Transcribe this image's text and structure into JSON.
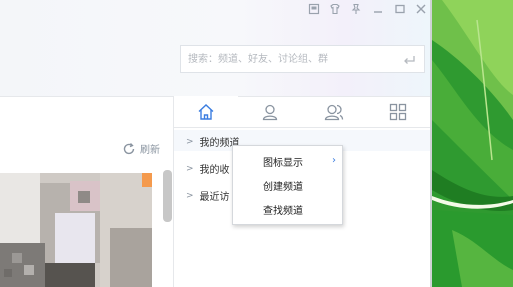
{
  "search": {
    "placeholder": "搜索：频道、好友、讨论组、群"
  },
  "refresh": {
    "label": "刷新"
  },
  "tree": {
    "items": [
      {
        "label": "我的频道"
      },
      {
        "label": "我的收"
      },
      {
        "label": "最近访"
      }
    ]
  },
  "context_menu": {
    "items": [
      {
        "label": "图标显示",
        "has_submenu": true
      },
      {
        "label": "创建频道"
      },
      {
        "label": "查找频道"
      }
    ]
  },
  "tabs": [
    {
      "icon": "home-icon",
      "active": true
    },
    {
      "icon": "contact-icon"
    },
    {
      "icon": "group-icon"
    },
    {
      "icon": "grid-icon"
    }
  ],
  "window_controls": [
    "skin-icon",
    "shirt-icon",
    "pin-icon",
    "minimize-icon",
    "maximize-icon",
    "close-icon"
  ],
  "colors": {
    "accent": "#3b7de0",
    "icon": "#8a94a0",
    "wallpaper": "#3aa23a"
  }
}
